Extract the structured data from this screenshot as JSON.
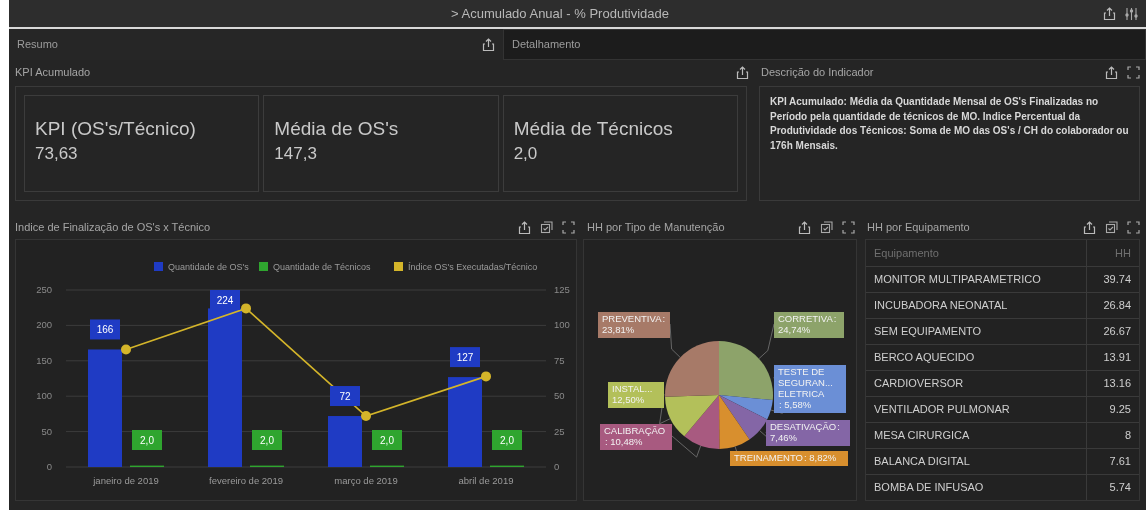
{
  "window": {
    "title": "> Acumulado Anual - % Produtividade",
    "tools": [
      {
        "kind": "share"
      },
      {
        "kind": "settings"
      }
    ]
  },
  "tabs": [
    {
      "label": "Resumo",
      "selected": true,
      "tools": [
        {
          "kind": "share"
        }
      ]
    },
    {
      "label": "Detalhamento",
      "selected": false
    }
  ],
  "kpi_section": {
    "title": "KPI Acumulado",
    "tools": [
      {
        "kind": "share"
      }
    ],
    "cards": [
      {
        "label": "KPI (OS's/Técnico)",
        "value": "73,63"
      },
      {
        "label": "Média de OS's",
        "value": "147,3"
      },
      {
        "label": "Média de Técnicos",
        "value": "2,0"
      }
    ]
  },
  "description": {
    "title": "Descrição do Indicador",
    "tools": [
      {
        "kind": "share"
      },
      {
        "kind": "expand"
      }
    ],
    "text": "KPI Acumulado: Média da Quantidade Mensal de OS's Finalizadas no Período pela quantidade de técnicos de MO. Indice Percentual da Produtividade dos Técnicos: Soma de MO das OS's / CH do colaborador ou 176h Mensais."
  },
  "bar_panel": {
    "title": "Indice de Finalização de OS's x Técnico",
    "tools": [
      {
        "kind": "share"
      },
      {
        "kind": "focus"
      },
      {
        "kind": "expand"
      }
    ],
    "chart_data": {
      "type": "bar",
      "categories": [
        "janeiro de 2019",
        "fevereiro de 2019",
        "março de 2019",
        "abril de 2019"
      ],
      "stacked": false,
      "grid": true,
      "legend": true,
      "ylim": [
        0,
        250
      ],
      "yticks": [
        0,
        50,
        100,
        150,
        200,
        250
      ],
      "y2lim": [
        0,
        125
      ],
      "y2ticks": [
        0,
        25,
        50,
        75,
        100,
        125
      ],
      "series": [
        {
          "name": "Quantidade de OS's",
          "color": "#1f3bc4",
          "values": [
            166,
            224,
            72,
            127
          ],
          "value_labels": [
            "166",
            "224",
            "72",
            "127"
          ]
        },
        {
          "name": "Quantidade de Técnicos",
          "color": "#2fa52f",
          "values": [
            2,
            2,
            2,
            2
          ],
          "value_labels": [
            "2,0",
            "2,0",
            "2,0",
            "2,0"
          ]
        },
        {
          "name": "Índice OS's Executadas/Técnico",
          "type": "line",
          "axis": "y2",
          "marker": "circle",
          "color": "#d4b52a",
          "values": [
            83,
            112,
            36,
            64
          ]
        }
      ]
    }
  },
  "pie_panel": {
    "title": "HH por Tipo de Manutenção",
    "label_separator": ":",
    "tools": [
      {
        "kind": "share"
      },
      {
        "kind": "focus"
      },
      {
        "kind": "expand"
      }
    ],
    "chart_data": {
      "type": "pie",
      "categories": [
        "CORRETIVA",
        "TESTE DE SEGURAN... ELETRICA",
        "DESATIVAÇÃO",
        "TREINAMENTO",
        "CALIBRAÇÃO",
        "INSTAL...",
        "PREVENTIVA"
      ],
      "values": [
        24.74,
        5.58,
        7.46,
        8.82,
        10.48,
        12.5,
        23.81
      ],
      "colors": [
        "#8da36a",
        "#6b8fd6",
        "#8466a6",
        "#d88f2e",
        "#a85a80",
        "#b3c05a",
        "#a77a68"
      ],
      "value_labels": [
        "24,74%",
        "5,58%",
        "7,46%",
        "8,82%",
        "10,48%",
        "12,50%",
        "23,81%"
      ]
    }
  },
  "table_panel": {
    "title": "HH por Equipamento",
    "tools": [
      {
        "kind": "share"
      },
      {
        "kind": "focus"
      },
      {
        "kind": "expand"
      }
    ],
    "columns": [
      "Equipamento",
      "HH"
    ],
    "rows": [
      [
        "MONITOR MULTIPARAMETRICO",
        "39.74"
      ],
      [
        "INCUBADORA NEONATAL",
        "26.84"
      ],
      [
        "SEM EQUIPAMENTO",
        "26.67"
      ],
      [
        "BERCO AQUECIDO",
        "13.91"
      ],
      [
        "CARDIOVERSOR",
        "13.16"
      ],
      [
        "VENTILADOR PULMONAR",
        "9.25"
      ],
      [
        "MESA CIRURGICA",
        "8"
      ],
      [
        "BALANCA DIGITAL",
        "7.61"
      ],
      [
        "BOMBA DE INFUSAO",
        "5.74"
      ]
    ]
  }
}
